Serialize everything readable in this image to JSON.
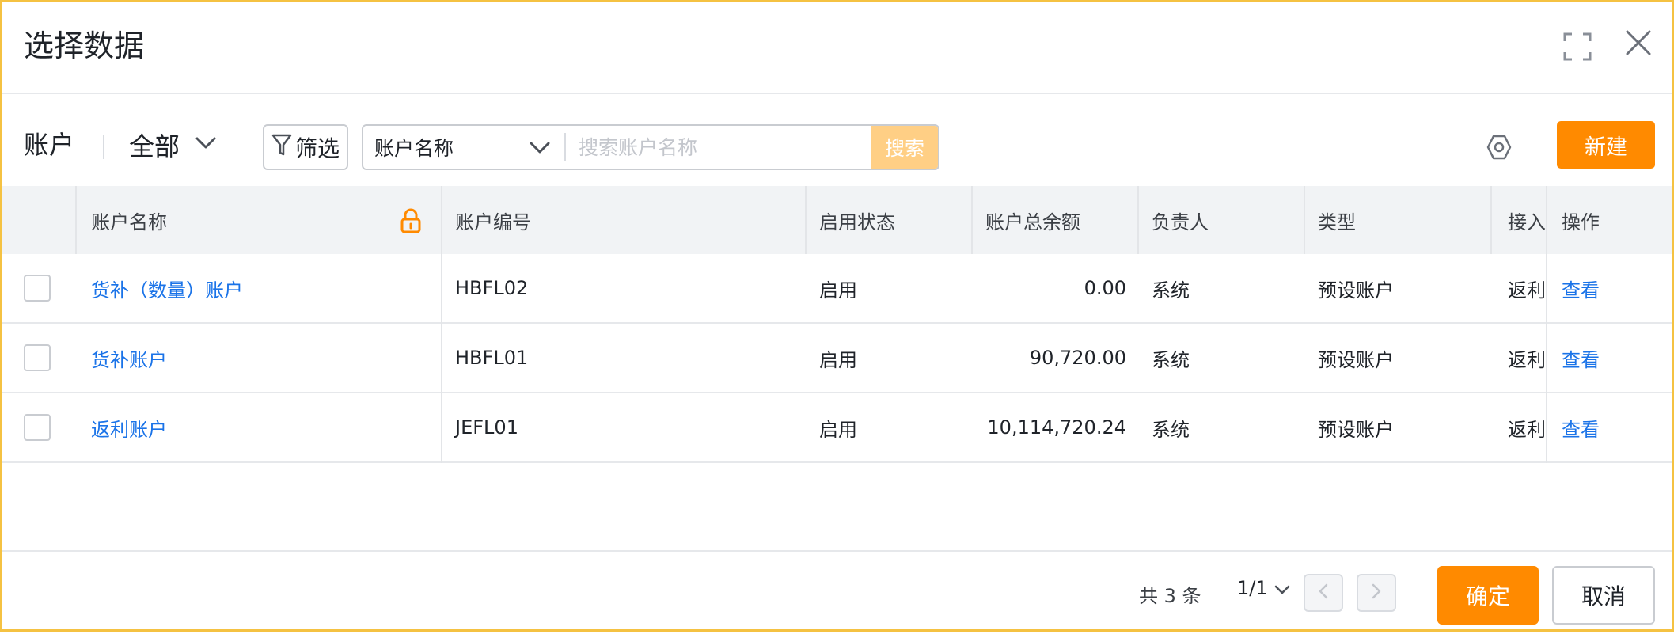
{
  "dialog": {
    "title": "选择数据"
  },
  "toolbar": {
    "label": "账户",
    "scope": "全部",
    "filter_label": "筛选",
    "search_field": "账户名称",
    "search_placeholder": "搜索账户名称",
    "search_button": "搜索",
    "new_button": "新建"
  },
  "table": {
    "columns": {
      "name": "账户名称",
      "code": "账户编号",
      "status": "启用状态",
      "balance": "账户总余额",
      "owner": "负责人",
      "type": "类型",
      "access": "接入",
      "action": "操作"
    },
    "rows": [
      {
        "name": "货补（数量）账户",
        "code": "HBFL02",
        "status": "启用",
        "balance": "0.00",
        "owner": "系统",
        "type": "预设账户",
        "access": "返利",
        "action": "查看"
      },
      {
        "name": "货补账户",
        "code": "HBFL01",
        "status": "启用",
        "balance": "90,720.00",
        "owner": "系统",
        "type": "预设账户",
        "access": "返利",
        "action": "查看"
      },
      {
        "name": "返利账户",
        "code": "JEFL01",
        "status": "启用",
        "balance": "10,114,720.24",
        "owner": "系统",
        "type": "预设账户",
        "access": "返利",
        "action": "查看"
      }
    ]
  },
  "footer": {
    "total": "共 3 条",
    "page": "1/1",
    "confirm": "确定",
    "cancel": "取消"
  },
  "colors": {
    "accent": "#ff8a00",
    "link": "#1a73e8",
    "search_button": "#ffcf85"
  }
}
